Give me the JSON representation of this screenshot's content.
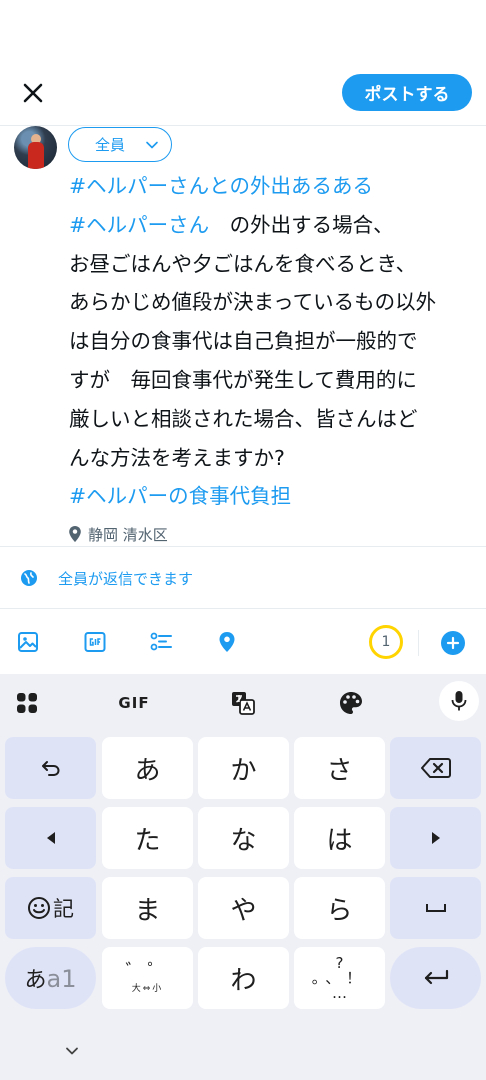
{
  "header": {
    "post_label": "ポストする"
  },
  "compose": {
    "audience_label": "全員",
    "lines": [
      {
        "parts": [
          {
            "text": "#ヘルパーさんとの外出あるある",
            "tag": true
          }
        ]
      },
      {
        "parts": [
          {
            "text": "#ヘルパーさん",
            "tag": true
          },
          {
            "text": "　の外出する場合、",
            "tag": false
          }
        ]
      },
      {
        "parts": [
          {
            "text": "お昼ごはんや夕ごはんを食べるとき、",
            "tag": false
          }
        ]
      },
      {
        "parts": [
          {
            "text": "あらかじめ値段が決まっているもの以外",
            "tag": false
          }
        ]
      },
      {
        "parts": [
          {
            "text": "は自分の食事代は自己負担が一般的で",
            "tag": false
          }
        ]
      },
      {
        "parts": [
          {
            "text": "すが　毎回食事代が発生して費用的に",
            "tag": false
          }
        ]
      },
      {
        "parts": [
          {
            "text": "厳しいと相談された場合、皆さんはど",
            "tag": false
          }
        ]
      },
      {
        "parts": [
          {
            "text": "んな方法を考えますか?",
            "tag": false
          }
        ]
      },
      {
        "parts": [
          {
            "text": "#ヘルパーの食事代負担",
            "tag": true
          }
        ]
      }
    ],
    "location": "静岡 清水区",
    "reply_setting": "全員が返信できます"
  },
  "toolbar": {
    "counter": "1"
  },
  "keyboard": {
    "gif_label": "GIF",
    "keys": {
      "a": "あ",
      "ka": "か",
      "sa": "さ",
      "ta": "た",
      "na": "な",
      "ha": "は",
      "ma": "ま",
      "ya": "や",
      "ra": "ら",
      "wa": "わ",
      "emoji_symbol": "記",
      "mode_kana": "あ",
      "mode_alpha": "a1",
      "dakuten_top": "゛゜",
      "dakuten_bottom": "大⇔小",
      "punct_top": "?",
      "punct_mid": "。、！",
      "punct_bottom": "…"
    }
  },
  "colors": {
    "accent": "#1d9bf0",
    "counter_ring": "#ffd400",
    "kb_function_key": "#dfe3f6",
    "kb_background": "#eef0f6"
  },
  "icons": [
    "close-icon",
    "chevron-down-icon",
    "location-pin-icon",
    "globe-icon",
    "image-icon",
    "gif-icon",
    "poll-icon",
    "location-icon",
    "plus-icon",
    "apps-grid-icon",
    "translate-icon",
    "palette-icon",
    "microphone-icon",
    "undo-icon",
    "backspace-icon",
    "arrow-left-icon",
    "arrow-right-icon",
    "space-icon",
    "enter-icon",
    "emoji-icon",
    "keyboard-collapse-icon"
  ]
}
